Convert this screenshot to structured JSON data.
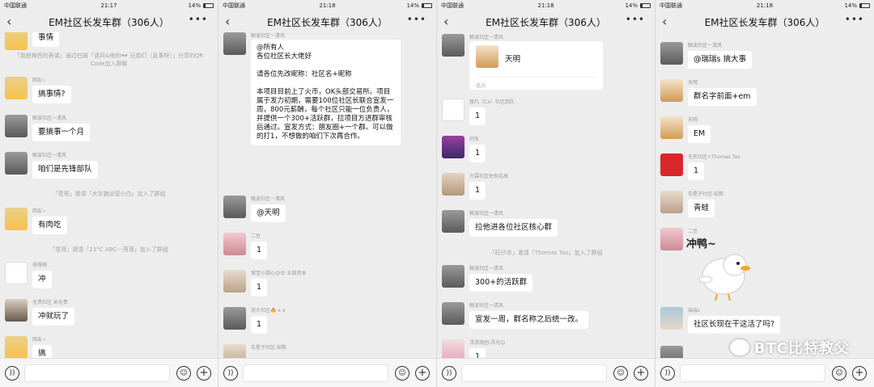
{
  "watermark": "BTC比特教父",
  "phones": [
    {
      "status": {
        "carrier": "中国联通",
        "time": "21:17",
        "battery": "14%"
      },
      "title": "EM社区长发车群（306人）",
      "messages": [
        {
          "type": "bubble",
          "nick": "",
          "text": "事情",
          "avatar": "av-anime"
        },
        {
          "type": "system",
          "text": "「我是梅西的表弟」通过扫描「请风&他的🕶 兄弟们（急事呀）」分享的QR Code加入群聊"
        },
        {
          "type": "bubble",
          "nick": "网友~",
          "text": "搞事情?",
          "avatar": "av-anime"
        },
        {
          "type": "bubble",
          "nick": "鲸波社区一清风",
          "text": "要搞事一个月",
          "avatar": "av-dark"
        },
        {
          "type": "bubble",
          "nick": "鲸波社区一清风",
          "text": "咱们是先锋部队",
          "avatar": "av-dark"
        },
        {
          "type": "system",
          "text": "「雪哥」邀请「大灰狼运营小白」加入了群组"
        },
        {
          "type": "bubble",
          "nick": "网友~",
          "text": "有肉吃",
          "avatar": "av-anime"
        },
        {
          "type": "system",
          "text": "「雪哥」邀请「23°C  ABC---落落」加入了群组"
        },
        {
          "type": "bubble",
          "nick": "得得得",
          "text": "冲",
          "avatar": "av-white"
        },
        {
          "type": "bubble",
          "nick": "无畏社区 米无畏",
          "text": "冲就玩了",
          "avatar": "av-man"
        },
        {
          "type": "bubble",
          "nick": "网友~",
          "text": "搞",
          "avatar": "av-anime"
        }
      ]
    },
    {
      "status": {
        "carrier": "中国联通",
        "time": "21:18",
        "battery": "14%"
      },
      "title": "EM社区长发车群（306人）",
      "messages": [
        {
          "type": "bubble",
          "nick": "鲸波社区一清风",
          "text": "@所有人\n各位社区长大佬好\n\n请各位先改昵称：社区名+昵称\n\n本项目目前上了火币，OK头部交易所。项目属于发力初期，需要100位社区长联合宣发一周，800元薪酬，每个社区只能一位负责人，并提供一个300+活跃群，拉项目方进群审核后通过。宣发方式：朋友圈+一个群。可以做的打1，不想做的咱们下次再合作。",
          "avatar": "av-dark"
        },
        {
          "type": "bubble",
          "nick": "鲸波社区一清风",
          "text": "@天明",
          "avatar": "av-dark"
        },
        {
          "type": "bubble",
          "nick": "二豆",
          "text": "1",
          "avatar": "av-pink"
        },
        {
          "type": "bubble",
          "nick": "琛宝小甜心😍😍·五部资本",
          "text": "1",
          "avatar": "av-girl"
        },
        {
          "type": "bubble",
          "nick": "涂大社区🔥 x x",
          "text": "1",
          "avatar": "av-dark"
        },
        {
          "type": "bubble",
          "nick": "车星子社区-知默",
          "text": "",
          "avatar": "av-girl"
        }
      ]
    },
    {
      "status": {
        "carrier": "中国联通",
        "time": "21:18",
        "battery": "14%"
      },
      "title": "EM社区长发车群（306人）",
      "messages": [
        {
          "type": "card",
          "nick": "鲸波社区一清风",
          "name": "天明",
          "caption": "名片",
          "avatar": "av-dark"
        },
        {
          "type": "bubble",
          "nick": "强凡（Cx）社区团队",
          "text": "1",
          "avatar": "av-white"
        },
        {
          "type": "bubble",
          "nick": "同东",
          "text": "1",
          "avatar": "av-purple"
        },
        {
          "type": "bubble",
          "nick": "大霖社区佐祝毛高",
          "text": "1",
          "avatar": "av-tan"
        },
        {
          "type": "bubble",
          "nick": "鲸波社区一清风",
          "text": "拉他进各位社区核心群",
          "avatar": "av-dark"
        },
        {
          "type": "system",
          "text": "「旺仔😡」邀请「Thomas Tao」加入了群组"
        },
        {
          "type": "bubble",
          "nick": "鲸波社区一清风",
          "text": "300+的活跃群",
          "avatar": "av-dark"
        },
        {
          "type": "bubble",
          "nick": "鲸波社区一清风",
          "text": "宣发一周，群名称之后统一改。",
          "avatar": "av-dark"
        },
        {
          "type": "bubble",
          "nick": "浮游旅团-浮光😊",
          "text": "1",
          "avatar": "av-lotus"
        }
      ]
    },
    {
      "status": {
        "carrier": "中国联通",
        "time": "21:18",
        "battery": "14%"
      },
      "title": "EM社区长发车群（306人）",
      "messages": [
        {
          "type": "bubble",
          "nick": "鲸波社区一清风",
          "text": "@瑞瑞s 搞大事",
          "avatar": "av-dark"
        },
        {
          "type": "bubble",
          "nick": "天明",
          "text": "群名字前面+em",
          "avatar": "av-luffy"
        },
        {
          "type": "bubble",
          "nick": "天明",
          "text": "EM",
          "avatar": "av-luffy"
        },
        {
          "type": "bubble",
          "nick": "无名社区+Thomas Tao",
          "text": "1",
          "avatar": "av-red"
        },
        {
          "type": "bubble",
          "nick": "车星子社区-知默",
          "text": "青蛙",
          "avatar": "av-girl"
        },
        {
          "type": "sticker",
          "nick": "二豆",
          "text": "冲鸭~",
          "avatar": "av-pink"
        },
        {
          "type": "bubble",
          "nick": "瑞瑞s",
          "text": "社区长现在干这活了吗?",
          "avatar": "av-beach"
        }
      ]
    }
  ]
}
